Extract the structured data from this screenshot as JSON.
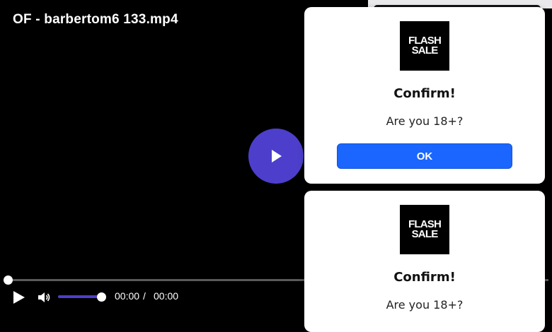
{
  "player": {
    "title": "OF - barbertom6 133.mp4",
    "current_time": "00:00",
    "time_separator": "/",
    "duration": "00:00",
    "progress_fraction": 0,
    "volume_fraction": 1,
    "accent_color": "#4d3fcc"
  },
  "modals": [
    {
      "logo_line1": "FLASH",
      "logo_line2": "SALE",
      "title": "Confirm!",
      "message": "Are you 18+?",
      "ok_label": "OK",
      "button_color": "#1a66ff"
    },
    {
      "logo_line1": "FLASH",
      "logo_line2": "SALE",
      "title": "Confirm!",
      "message": "Are you 18+?"
    }
  ]
}
